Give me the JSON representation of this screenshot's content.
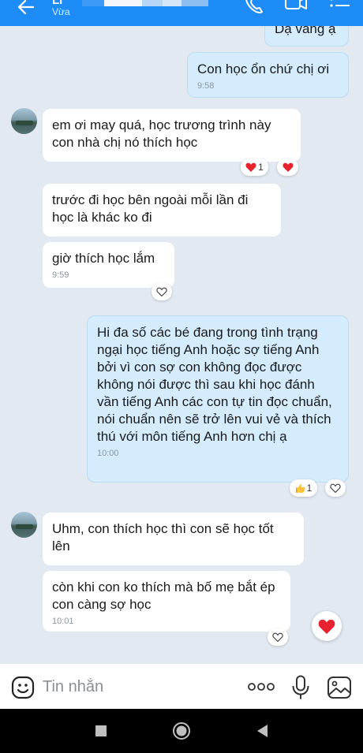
{
  "header": {
    "name": "Li",
    "status": "Vừa"
  },
  "messages": [
    {
      "text": "Dạ vâng ạ"
    },
    {
      "text": "Con học ổn chứ chị ơi",
      "time": "9:58"
    },
    {
      "text": "em ơi may quá, học trương trình này con nhà chị nó thích học",
      "reaction_count": "1"
    },
    {
      "text": "trước đi học bên ngoài mỗi lần đi học là khác ko đi"
    },
    {
      "text": "giờ thích học lắm",
      "time": "9:59"
    },
    {
      "text": "Hi đa số các bé đang trong tình trạng ngại học tiếng Anh hoặc sợ tiếng Anh bởi vì con sợ con không đọc được không nói được thì sau khi học đánh vần tiếng Anh các con tự tin đọc chuẩn, nói chuẩn nên sẽ trở lên vui vẻ và thích thú với môn tiếng Anh hơn chị ạ",
      "time": "10:00",
      "reaction_count": "1"
    },
    {
      "text": "Uhm, con thích học thì con sẽ học tốt lên"
    },
    {
      "text": "còn khi con ko thích mà bố mẹ bắt ép con càng sợ học",
      "time": "10:01"
    }
  ],
  "input": {
    "placeholder": "Tin nhắn"
  },
  "colors": {
    "header_bg": "#1e8cf6",
    "chat_bg": "#e2e9f1",
    "sent_bubble": "#d4ecfd",
    "received_bubble": "#ffffff",
    "heart": "#e8222f"
  },
  "icons": {
    "header": [
      "back-arrow-icon",
      "phone-icon",
      "video-call-icon",
      "menu-list-icon"
    ],
    "input": [
      "emoji-icon",
      "more-dots-icon",
      "microphone-icon",
      "image-icon"
    ],
    "nav": [
      "recent-apps-icon",
      "home-icon",
      "back-triangle-icon"
    ]
  }
}
